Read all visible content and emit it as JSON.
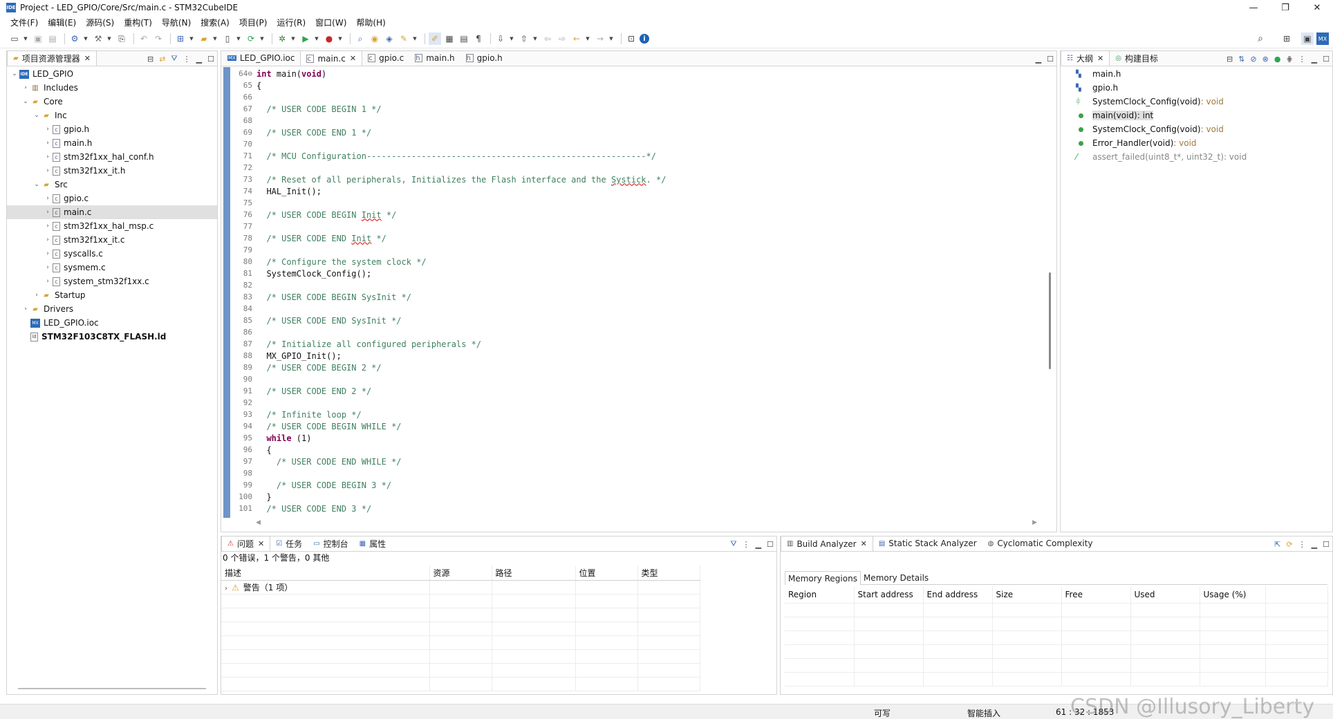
{
  "window": {
    "title": "Project - LED_GPIO/Core/Src/main.c - STM32CubeIDE",
    "logo": "IDE",
    "controls": [
      "—",
      "❐",
      "✕"
    ]
  },
  "menu": [
    "文件(F)",
    "编辑(E)",
    "源码(S)",
    "重构(T)",
    "导航(N)",
    "搜索(A)",
    "项目(P)",
    "运行(R)",
    "窗口(W)",
    "帮助(H)"
  ],
  "explorer": {
    "title": "项目资源管理器",
    "items": [
      {
        "label": "LED_GPIO",
        "depth": 0,
        "arrow": "⌄",
        "icon": "project"
      },
      {
        "label": "Includes",
        "depth": 1,
        "arrow": "›",
        "icon": "includes"
      },
      {
        "label": "Core",
        "depth": 1,
        "arrow": "⌄",
        "icon": "folder"
      },
      {
        "label": "Inc",
        "depth": 2,
        "arrow": "⌄",
        "icon": "folder"
      },
      {
        "label": "gpio.h",
        "depth": 3,
        "arrow": "›",
        "icon": "file"
      },
      {
        "label": "main.h",
        "depth": 3,
        "arrow": "›",
        "icon": "file"
      },
      {
        "label": "stm32f1xx_hal_conf.h",
        "depth": 3,
        "arrow": "›",
        "icon": "file"
      },
      {
        "label": "stm32f1xx_it.h",
        "depth": 3,
        "arrow": "›",
        "icon": "file"
      },
      {
        "label": "Src",
        "depth": 2,
        "arrow": "⌄",
        "icon": "folder"
      },
      {
        "label": "gpio.c",
        "depth": 3,
        "arrow": "›",
        "icon": "file"
      },
      {
        "label": "main.c",
        "depth": 3,
        "arrow": "›",
        "icon": "file",
        "selected": true
      },
      {
        "label": "stm32f1xx_hal_msp.c",
        "depth": 3,
        "arrow": "›",
        "icon": "file"
      },
      {
        "label": "stm32f1xx_it.c",
        "depth": 3,
        "arrow": "›",
        "icon": "file"
      },
      {
        "label": "syscalls.c",
        "depth": 3,
        "arrow": "›",
        "icon": "file"
      },
      {
        "label": "sysmem.c",
        "depth": 3,
        "arrow": "›",
        "icon": "file"
      },
      {
        "label": "system_stm32f1xx.c",
        "depth": 3,
        "arrow": "›",
        "icon": "file"
      },
      {
        "label": "Startup",
        "depth": 2,
        "arrow": "›",
        "icon": "folder"
      },
      {
        "label": "Drivers",
        "depth": 1,
        "arrow": "›",
        "icon": "folder"
      },
      {
        "label": "LED_GPIO.ioc",
        "depth": 1,
        "arrow": "",
        "icon": "mx"
      },
      {
        "label": "STM32F103C8TX_FLASH.ld",
        "depth": 1,
        "arrow": "",
        "icon": "ld",
        "bold": true
      }
    ]
  },
  "editor": {
    "tabs": [
      {
        "label": "LED_GPIO.ioc",
        "icon": "MX"
      },
      {
        "label": "main.c",
        "icon": "c",
        "active": true
      },
      {
        "label": "gpio.c",
        "icon": "c"
      },
      {
        "label": "main.h",
        "icon": "h"
      },
      {
        "label": "gpio.h",
        "icon": "h"
      }
    ],
    "lines": [
      {
        "n": "64⊖",
        "segs": [
          [
            "kw",
            "int"
          ],
          [
            "",
            " main("
          ],
          [
            "kw",
            "void"
          ],
          [
            "",
            ")"
          ]
        ]
      },
      {
        "n": "65",
        "segs": [
          [
            "",
            "{"
          ]
        ]
      },
      {
        "n": "66",
        "segs": []
      },
      {
        "n": "67",
        "segs": [
          [
            "cm",
            "  /* USER CODE BEGIN 1 */"
          ]
        ]
      },
      {
        "n": "68",
        "segs": []
      },
      {
        "n": "69",
        "segs": [
          [
            "cm",
            "  /* USER CODE END 1 */"
          ]
        ]
      },
      {
        "n": "70",
        "segs": []
      },
      {
        "n": "71",
        "segs": [
          [
            "cm",
            "  /* MCU Configuration--------------------------------------------------------*/"
          ]
        ]
      },
      {
        "n": "72",
        "segs": []
      },
      {
        "n": "73",
        "segs": [
          [
            "cm",
            "  /* Reset of all peripherals, Initializes the Flash interface and the "
          ],
          [
            "cm wavy",
            "Systick"
          ],
          [
            "cm",
            ". */"
          ]
        ]
      },
      {
        "n": "74",
        "segs": [
          [
            "",
            "  HAL_Init();"
          ]
        ]
      },
      {
        "n": "75",
        "segs": []
      },
      {
        "n": "76",
        "segs": [
          [
            "cm",
            "  /* USER CODE BEGIN "
          ],
          [
            "cm wavy",
            "Init"
          ],
          [
            "cm",
            " */"
          ]
        ]
      },
      {
        "n": "77",
        "segs": []
      },
      {
        "n": "78",
        "segs": [
          [
            "cm",
            "  /* USER CODE END "
          ],
          [
            "cm wavy",
            "Init"
          ],
          [
            "cm",
            " */"
          ]
        ]
      },
      {
        "n": "79",
        "segs": []
      },
      {
        "n": "80",
        "segs": [
          [
            "cm",
            "  /* Configure the system clock */"
          ]
        ]
      },
      {
        "n": "81",
        "segs": [
          [
            "",
            "  SystemClock_Config();"
          ]
        ]
      },
      {
        "n": "82",
        "segs": []
      },
      {
        "n": "83",
        "segs": [
          [
            "cm",
            "  /* USER CODE BEGIN SysInit */"
          ]
        ]
      },
      {
        "n": "84",
        "segs": []
      },
      {
        "n": "85",
        "segs": [
          [
            "cm",
            "  /* USER CODE END SysInit */"
          ]
        ]
      },
      {
        "n": "86",
        "segs": []
      },
      {
        "n": "87",
        "segs": [
          [
            "cm",
            "  /* Initialize all configured peripherals */"
          ]
        ]
      },
      {
        "n": "88",
        "segs": [
          [
            "",
            "  MX_GPIO_Init();"
          ]
        ]
      },
      {
        "n": "89",
        "segs": [
          [
            "cm",
            "  /* USER CODE BEGIN 2 */"
          ]
        ]
      },
      {
        "n": "90",
        "segs": []
      },
      {
        "n": "91",
        "segs": [
          [
            "cm",
            "  /* USER CODE END 2 */"
          ]
        ]
      },
      {
        "n": "92",
        "segs": []
      },
      {
        "n": "93",
        "segs": [
          [
            "cm",
            "  /* Infinite loop */"
          ]
        ]
      },
      {
        "n": "94",
        "segs": [
          [
            "cm",
            "  /* USER CODE BEGIN WHILE */"
          ]
        ]
      },
      {
        "n": "95",
        "segs": [
          [
            "kw",
            "  while"
          ],
          [
            "",
            " (1)"
          ]
        ]
      },
      {
        "n": "96",
        "segs": [
          [
            "",
            "  {"
          ]
        ]
      },
      {
        "n": "97",
        "segs": [
          [
            "cm",
            "    /* USER CODE END WHILE */"
          ]
        ]
      },
      {
        "n": "98",
        "segs": []
      },
      {
        "n": "99",
        "segs": [
          [
            "cm",
            "    /* USER CODE BEGIN 3 */"
          ]
        ]
      },
      {
        "n": "100",
        "segs": [
          [
            "",
            "  }"
          ]
        ]
      },
      {
        "n": "101",
        "segs": [
          [
            "cm",
            "  /* USER CODE END 3 */"
          ]
        ]
      }
    ]
  },
  "outline": {
    "tabs": [
      "大纲",
      "构建目标"
    ],
    "items": [
      {
        "label": "main.h",
        "type": "",
        "icon": "include"
      },
      {
        "label": "gpio.h",
        "type": "",
        "icon": "include"
      },
      {
        "label": "SystemClock_Config(void)",
        "type": " : void",
        "icon": "decl"
      },
      {
        "label": "main(void)",
        "type": " : int",
        "icon": "func",
        "selected": true
      },
      {
        "label": "SystemClock_Config(void)",
        "type": " : void",
        "icon": "func"
      },
      {
        "label": "Error_Handler(void)",
        "type": " : void",
        "icon": "func"
      },
      {
        "label": "assert_failed(uint8_t*, uint32_t)",
        "type": " : void",
        "icon": "inactive",
        "dim": true
      }
    ]
  },
  "problems": {
    "tabs": [
      "问题",
      "任务",
      "控制台",
      "属性"
    ],
    "summary": "0 个错误，1 个警告，0 其他",
    "columns": [
      "描述",
      "资源",
      "路径",
      "位置",
      "类型"
    ],
    "rows": [
      {
        "label": "警告（1 项）"
      }
    ]
  },
  "build": {
    "tabs": [
      "Build Analyzer",
      "Static Stack Analyzer",
      "Cyclomatic Complexity"
    ],
    "subtabs": [
      "Memory Regions",
      "Memory Details"
    ],
    "columns": [
      "Region",
      "Start address",
      "End address",
      "Size",
      "Free",
      "Used",
      "Usage (%)"
    ]
  },
  "status": {
    "writable": "可写",
    "insert_mode": "智能插入",
    "position": "61 : 32 : 1853"
  },
  "watermark": "CSDN @Illusory_Liberty",
  "colors": {
    "comment": "#3f7f5f",
    "keyword": "#7f0055",
    "folder": "#d9a33a",
    "accent": "#2d6bb8",
    "active_run": "#2ea44f"
  }
}
